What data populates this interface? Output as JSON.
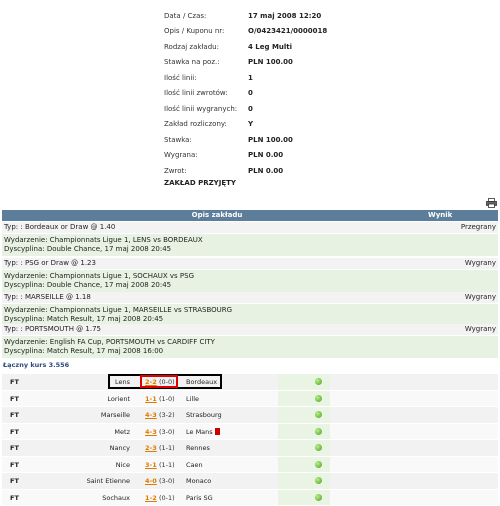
{
  "coupon": {
    "rows": [
      {
        "label": "Data / Czas:",
        "value": "17 maj 2008 12:20"
      },
      {
        "label": "Opis / Kuponu nr:",
        "value": "O/0423421/0000018"
      },
      {
        "label": "Rodzaj zakładu:",
        "value": "4 Leg Multi"
      },
      {
        "label": "Stawka na poz.:",
        "value": "PLN 100.00"
      },
      {
        "label": "Ilość linii:",
        "value": "1"
      },
      {
        "label": "Ilość linii zwrotów:",
        "value": "0"
      },
      {
        "label": "Ilość linii wygranych:",
        "value": "0"
      },
      {
        "label": "Zakład rozliczony:",
        "value": "Y"
      },
      {
        "label": "Stawka:",
        "value": "PLN 100.00"
      },
      {
        "label": "Wygrana:",
        "value": "PLN 0.00"
      },
      {
        "label": "Zwrot:",
        "value": "PLN 0.00"
      }
    ],
    "accepted": "ZAKŁAD PRZYJĘTY"
  },
  "table_header": {
    "desc": "Opis zakładu",
    "result": "Wynik"
  },
  "bets": [
    {
      "typ": "Typ: : Bordeaux or Draw @ 1.40",
      "result": "Przegrany",
      "event": "Wydarzenie: Championnats Ligue 1, LENS vs BORDEAUX",
      "disc": "Dyscyplina: Double Chance, 17 maj 2008 20:45"
    },
    {
      "typ": "Typ: : PSG or Draw @ 1.23",
      "result": "Wygrany",
      "event": "Wydarzenie: Championnats Ligue 1, SOCHAUX vs PSG",
      "disc": "Dyscyplina: Double Chance, 17 maj 2008 20:45"
    },
    {
      "typ": "Typ: : MARSEILLE @ 1.18",
      "result": "Wygrany",
      "event": "Wydarzenie: Championnats Ligue 1, MARSEILLE vs STRASBOURG",
      "disc": "Dyscyplina: Match Result, 17 maj 2008 20:45"
    },
    {
      "typ": "Typ: : PORTSMOUTH @ 1.75",
      "result": "Wygrany",
      "event": "Wydarzenie: English FA Cup, PORTSMOUTH vs CARDIFF CITY",
      "disc": "Dyscyplina: Match Result, 17 maj 2008 16:00"
    }
  ],
  "total": "Łączny kurs 3.556",
  "results": [
    {
      "status": "FT",
      "home": "Lens",
      "score": "2-2",
      "half": "(0-0)",
      "away": "Bordeaux"
    },
    {
      "status": "FT",
      "home": "Lorient",
      "score": "1-1",
      "half": "(1-0)",
      "away": "Lille"
    },
    {
      "status": "FT",
      "home": "Marseille",
      "score": "4-3",
      "half": "(3-2)",
      "away": "Strasbourg"
    },
    {
      "status": "FT",
      "home": "Metz",
      "score": "4-3",
      "half": "(3-0)",
      "away": "Le Mans"
    },
    {
      "status": "FT",
      "home": "Nancy",
      "score": "2-3",
      "half": "(1-1)",
      "away": "Rennes"
    },
    {
      "status": "FT",
      "home": "Nice",
      "score": "3-1",
      "half": "(1-1)",
      "away": "Caen"
    },
    {
      "status": "FT",
      "home": "Saint Etienne",
      "score": "4-0",
      "half": "(3-0)",
      "away": "Monaco"
    },
    {
      "status": "FT",
      "home": "Sochaux",
      "score": "1-2",
      "half": "(0-1)",
      "away": "Paris SG"
    }
  ],
  "colors": {
    "header": "#5d7e9a",
    "score": "#e07a00",
    "highlight_red": "#e00000",
    "event_bg": "#e8f2e3"
  }
}
